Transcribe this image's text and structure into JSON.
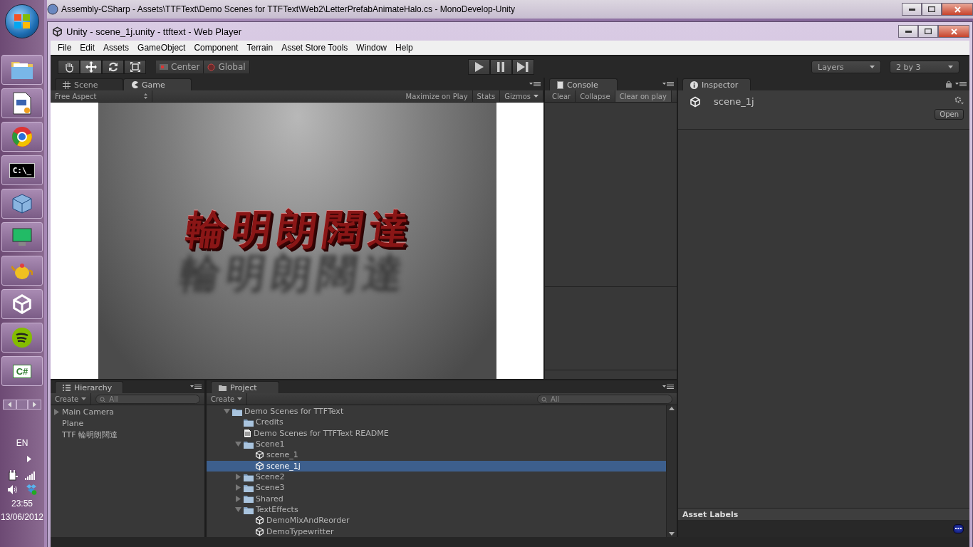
{
  "background_window": {
    "title": "Assembly-CSharp - Assets\\TTFText\\Demo Scenes for TTFText\\Web2\\LetterPrefabAnimateHalo.cs - MonoDevelop-Unity"
  },
  "taskbar": {
    "apps": [
      {
        "kind": "folder"
      },
      {
        "kind": "document"
      },
      {
        "kind": "browser"
      },
      {
        "kind": "terminal",
        "label": "C:\\_"
      },
      {
        "kind": "cube"
      },
      {
        "kind": "monitor"
      },
      {
        "kind": "teapot"
      },
      {
        "kind": "unity"
      },
      {
        "kind": "music"
      },
      {
        "kind": "csharp",
        "label": "C#"
      }
    ],
    "language": "EN",
    "time": "23:55",
    "date": "13/06/2012"
  },
  "unity": {
    "title": "Unity - scene_1j.unity - ttftext - Web Player",
    "menu": [
      "File",
      "Edit",
      "Assets",
      "GameObject",
      "Component",
      "Terrain",
      "Asset Store Tools",
      "Window",
      "Help"
    ],
    "tools": [
      {
        "kind": "hand",
        "selected": false
      },
      {
        "kind": "move",
        "selected": true
      },
      {
        "kind": "rotate",
        "selected": false
      },
      {
        "kind": "scale",
        "selected": false
      }
    ],
    "pivot": [
      {
        "kind": "center",
        "label": "Center"
      },
      {
        "kind": "global",
        "label": "Global"
      }
    ],
    "playback": [
      {
        "kind": "play",
        "selected": false
      },
      {
        "kind": "pause",
        "selected": false
      },
      {
        "kind": "step",
        "selected": false
      }
    ],
    "layers": "Layers",
    "layout": "2 by 3"
  },
  "game_panel": {
    "tabs": [
      {
        "kind": "scene",
        "label": "Scene",
        "selected": false
      },
      {
        "kind": "game",
        "label": "Game",
        "selected": true
      }
    ],
    "aspect": "Free Aspect",
    "options": [
      {
        "label": "Maximize on Play",
        "selected": false
      },
      {
        "label": "Stats",
        "selected": false
      },
      {
        "label": "Gizmos",
        "selected": false
      }
    ],
    "scene_text": "輪明朗闊達"
  },
  "console": {
    "tab": "Console",
    "buttons": [
      {
        "label": "Clear",
        "selected": false
      },
      {
        "label": "Collapse",
        "selected": false
      },
      {
        "label": "Clear on play",
        "selected": true
      }
    ]
  },
  "inspector": {
    "tab": "Inspector",
    "asset": "scene_1j",
    "open_button": "Open",
    "labels_heading": "Asset Labels"
  },
  "hierarchy": {
    "tab": "Hierarchy",
    "create": "Create",
    "search_placeholder": "All",
    "items": [
      {
        "label": "Main Camera",
        "expanded": false,
        "selected": false
      },
      {
        "label": "Plane",
        "selected": false
      },
      {
        "label": "TTF 輪明朗闊達",
        "selected": false
      }
    ]
  },
  "project": {
    "tab": "Project",
    "create": "Create",
    "search_placeholder": "All",
    "tree": [
      {
        "kind": "folder",
        "label": "Demo Scenes for TTFText",
        "expanded": true,
        "selected": false,
        "children": [
          {
            "kind": "folder",
            "label": "Credits",
            "selected": false
          },
          {
            "kind": "document",
            "label": "Demo Scenes for TTFText README",
            "selected": false
          },
          {
            "kind": "folder",
            "label": "Scene1",
            "expanded": true,
            "selected": false,
            "children": [
              {
                "kind": "scene",
                "label": "scene_1",
                "selected": false
              },
              {
                "kind": "scene",
                "label": "scene_1j",
                "selected": true
              }
            ]
          },
          {
            "kind": "folder",
            "label": "Scene2",
            "expanded": false,
            "selected": false
          },
          {
            "kind": "folder",
            "label": "Scene3",
            "expanded": false,
            "selected": false
          },
          {
            "kind": "folder",
            "label": "Shared",
            "expanded": false,
            "selected": false
          },
          {
            "kind": "folder",
            "label": "TextEffects",
            "expanded": true,
            "selected": false,
            "children": [
              {
                "kind": "scene",
                "label": "DemoMixAndReorder",
                "selected": false
              },
              {
                "kind": "scene",
                "label": "DemoTypewritter",
                "selected": false
              }
            ]
          }
        ]
      }
    ]
  }
}
